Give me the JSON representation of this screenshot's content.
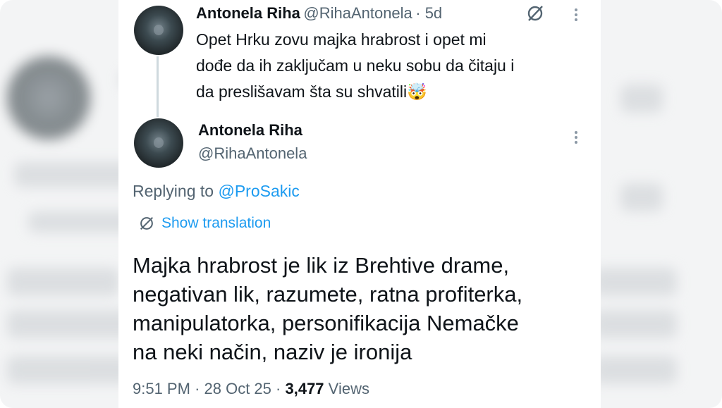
{
  "reply_tweet": {
    "name": "Antonela Riha",
    "handle": "@RihaAntonela",
    "time": "· 5d",
    "text_lines": [
      "Opet Hrku zovu majka hrabrost i opet mi",
      "dođe da ih zaključam u neku sobu da čitaju i",
      "da preslišavam šta su shvatili🤯"
    ]
  },
  "main_tweet": {
    "name": "Antonela Riha",
    "handle": "@RihaAntonela",
    "replying_prefix": "Replying to ",
    "replying_handle": "@ProSakic",
    "translate_label": "Show translation",
    "text_lines": [
      "Majka hrabrost je lik iz Brehtive drame,",
      "negativan lik, razumete, ratna profiterka,",
      "manipulatorka, personifikacija Nemačke",
      "na neki način, naziv je ironija"
    ],
    "meta": {
      "time": "9:51 PM",
      "sep1": "·",
      "date": "28 Oct 25",
      "sep2": "·",
      "views_count": "3,477",
      "views_label": "Views"
    }
  },
  "colors": {
    "link": "#1d9bf0",
    "muted": "#536471",
    "text": "#0f1419",
    "thread_line": "#cfd9de"
  },
  "icons": [
    "translate-icon",
    "grok-slash-icon",
    "more-dots-icon"
  ]
}
